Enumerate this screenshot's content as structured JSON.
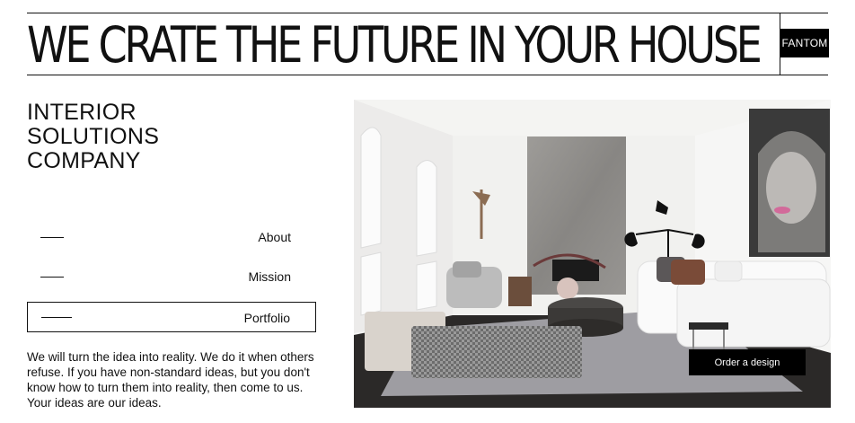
{
  "header": {
    "headline": "WE CRATE THE FUTURE IN YOUR HOUSE",
    "brand": "FANTOM"
  },
  "tagline": [
    "INTERIOR",
    "SOLUTIONS",
    "COMPANY"
  ],
  "nav": {
    "items": [
      {
        "label": "About"
      },
      {
        "label": "Mission"
      },
      {
        "label": "Portfolio",
        "selected": true
      }
    ]
  },
  "description": "We will turn the idea into reality. We do it when others refuse. If you have non-standard ideas, but you don't know how to turn them into reality, then come to us. Your ideas are our ideas.",
  "hero": {
    "cta_label": "Order a design"
  },
  "colors": {
    "text": "#111111",
    "accent": "#000000",
    "background": "#ffffff"
  }
}
